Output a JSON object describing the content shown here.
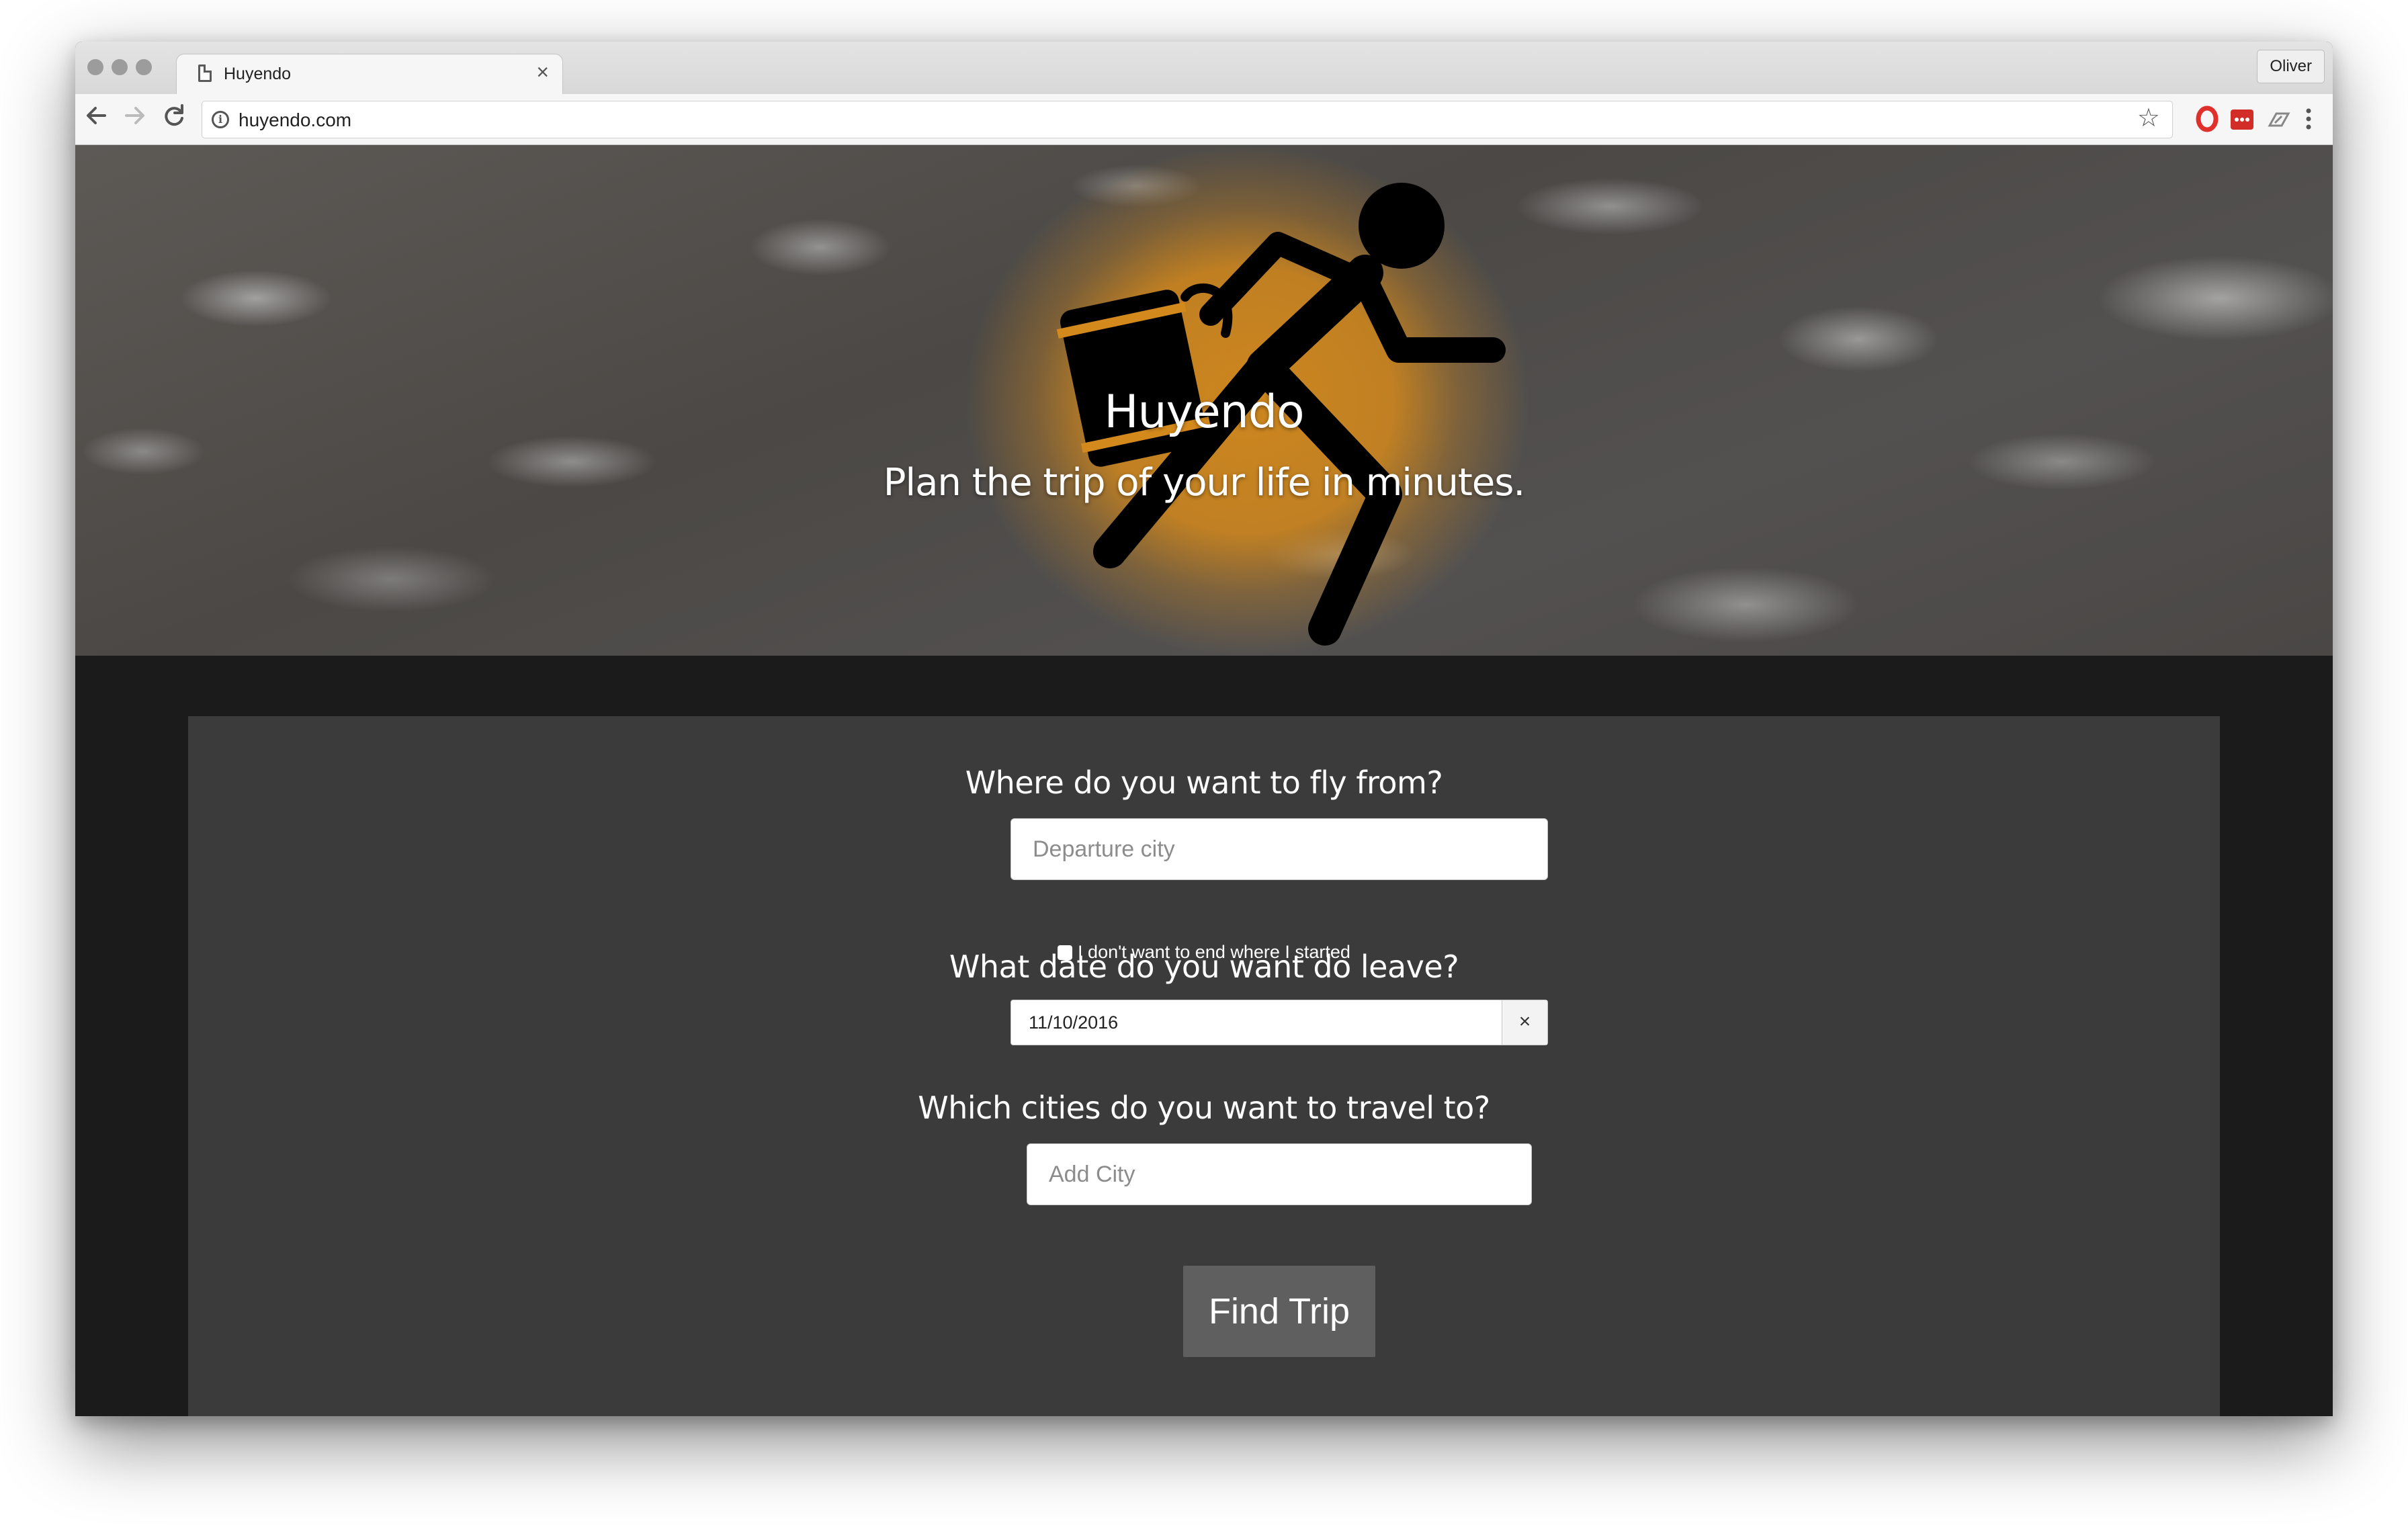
{
  "browser": {
    "tab_title": "Huyendo",
    "tab_close": "×",
    "profile_name": "Oliver",
    "url": "huyendo.com",
    "info_glyph": "i",
    "icons": [
      "back-arrow-icon",
      "forward-arrow-icon",
      "reload-icon",
      "info-icon",
      "star-icon",
      "opera-extension-icon",
      "lastpass-extension-icon",
      "reader-extension-icon",
      "kebab-menu-icon"
    ]
  },
  "hero": {
    "title": "Huyendo",
    "subtitle": "Plan the trip of your life in minutes.",
    "logo": "running-man-with-suitcase",
    "accent_color": "#d4891c"
  },
  "form": {
    "from_question": "Where do you want to fly from?",
    "from_placeholder": "Departure city",
    "roundtrip_label": "I don't want to end where I started",
    "date_question": "What date do you want do leave?",
    "date_value": "11/10/2016",
    "date_clear": "×",
    "cities_question": "Which cities do you want to travel to?",
    "cities_placeholder": "Add City",
    "submit_label": "Find Trip"
  },
  "colors": {
    "page_bg": "#1b1b1b",
    "panel_bg": "#3b3b3b",
    "button_bg": "#5f5f5f"
  }
}
